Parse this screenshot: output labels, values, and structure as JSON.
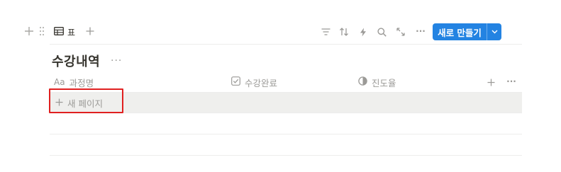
{
  "toolbar": {
    "view_label": "표",
    "new_button_label": "새로 만들기",
    "more_glyph": "···"
  },
  "database": {
    "title": "수강내역",
    "title_more_glyph": "···"
  },
  "columns": [
    {
      "icon": "text-property-icon",
      "icon_text": "Aa",
      "label": "과정명"
    },
    {
      "icon": "checkbox-property-icon",
      "label": "수강완료"
    },
    {
      "icon": "formula-progress-icon",
      "label": "진도율"
    }
  ],
  "header_more_glyph": "···",
  "new_page_label": "새 페이지",
  "colors": {
    "accent": "#2383e2",
    "highlight_box": "#e02020",
    "muted_text": "#9b9a97",
    "row_highlight": "#efefed"
  }
}
